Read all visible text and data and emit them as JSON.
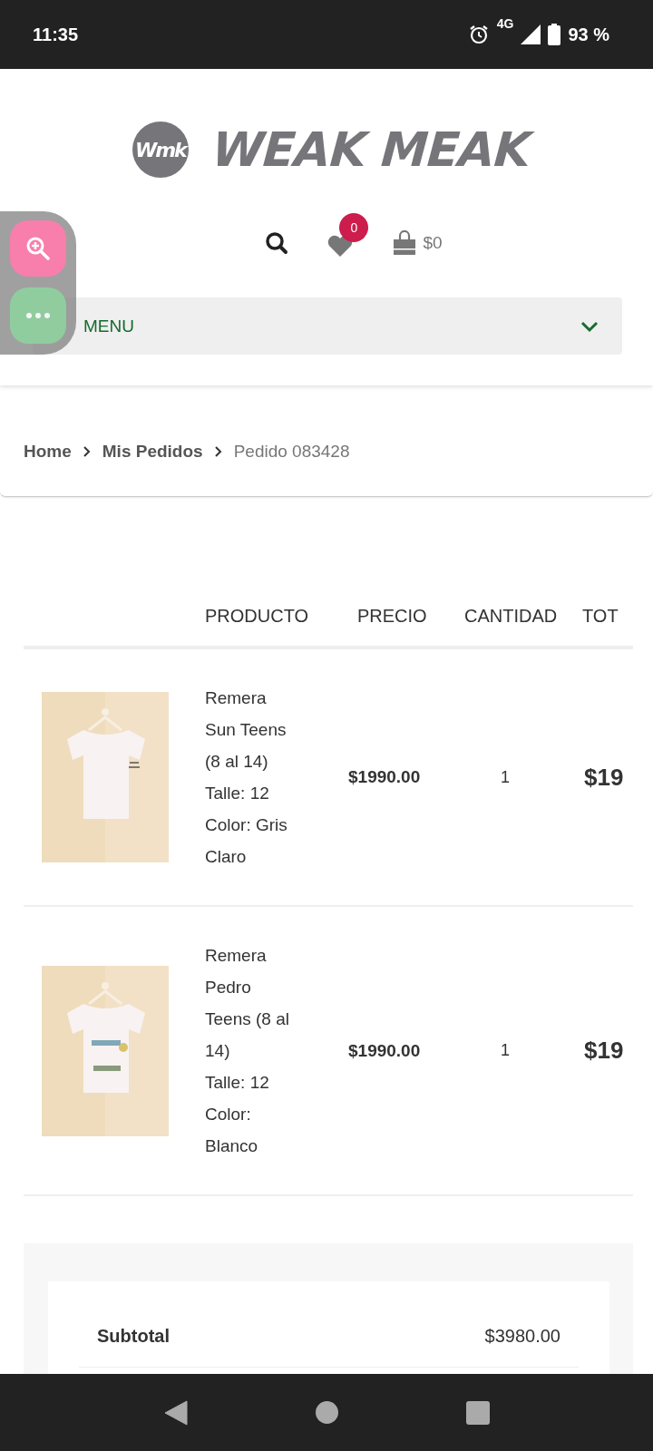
{
  "status_bar": {
    "time": "11:35",
    "network": "4G",
    "battery": "93 %"
  },
  "header": {
    "logo_mark": "Wmk",
    "logo_text": "WEAK MEAK",
    "wishlist_count": "0",
    "cart_total": "$0",
    "menu_label": "MENU"
  },
  "breadcrumb": [
    {
      "label": "Home",
      "link": true
    },
    {
      "label": "Mis Pedidos",
      "link": true
    },
    {
      "label": "Pedido 083428",
      "link": false
    }
  ],
  "table": {
    "columns": [
      "PRODUCTO",
      "PRECIO",
      "CANTIDAD",
      "TOT"
    ],
    "rows": [
      {
        "product": [
          "Remera",
          "Sun Teens",
          "(8 al 14)",
          "Talle: 12",
          "Color: Gris",
          "Claro"
        ],
        "price": "$1990.00",
        "quantity": "1",
        "total": "$19"
      },
      {
        "product": [
          "Remera",
          "Pedro",
          "Teens (8 al",
          "14)",
          "Talle: 12",
          "Color:",
          "Blanco"
        ],
        "price": "$1990.00",
        "quantity": "1",
        "total": "$19"
      }
    ]
  },
  "summary": {
    "rows": [
      {
        "label": "Subtotal",
        "value": "$3980.00"
      }
    ]
  }
}
